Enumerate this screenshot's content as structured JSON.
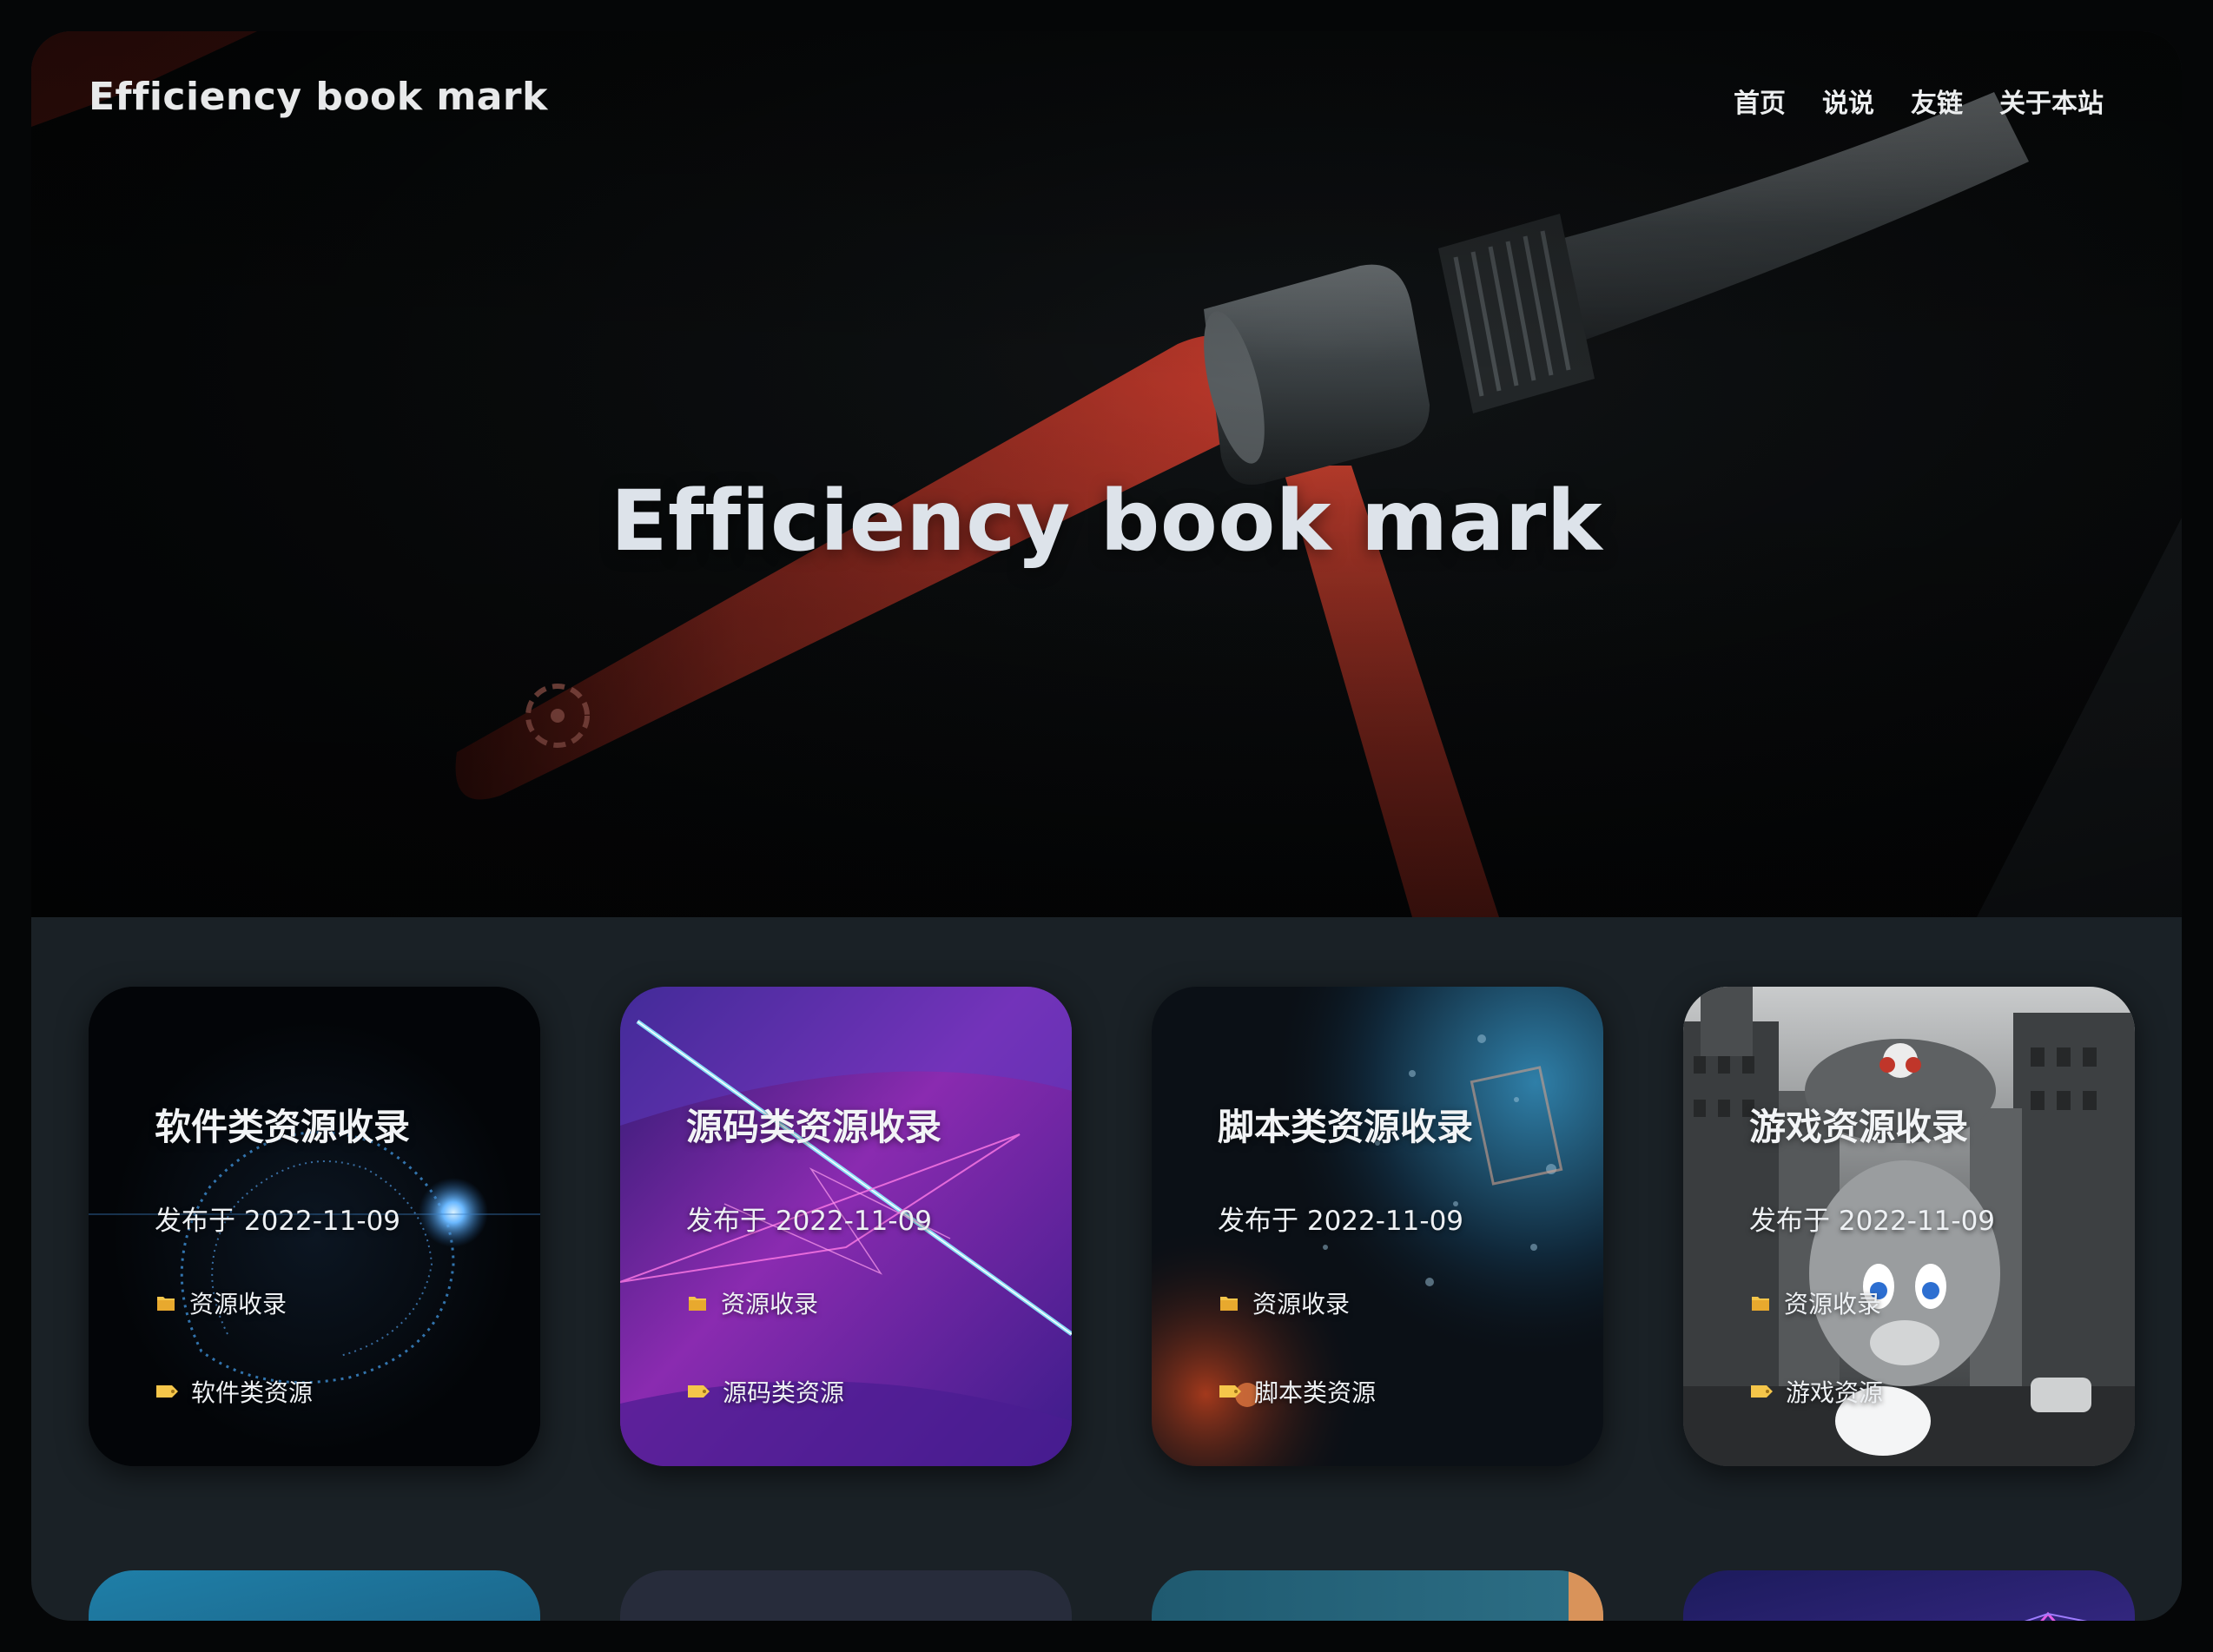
{
  "site": {
    "brand": "Efficiency book mark",
    "hero_title": "Efficiency book mark",
    "nav": [
      {
        "label": "首页"
      },
      {
        "label": "说说"
      },
      {
        "label": "友链"
      },
      {
        "label": "关于本站"
      }
    ]
  },
  "posts": [
    {
      "title": "软件类资源收录",
      "date": "发布于 2022-11-09",
      "category": "资源收录",
      "tag": "软件类资源"
    },
    {
      "title": "源码类资源收录",
      "date": "发布于 2022-11-09",
      "category": "资源收录",
      "tag": "源码类资源"
    },
    {
      "title": "脚本类资源收录",
      "date": "发布于 2022-11-09",
      "category": "资源收录",
      "tag": "脚本类资源"
    },
    {
      "title": "游戏资源收录",
      "date": "发布于 2022-11-09",
      "category": "资源收录",
      "tag": "游戏资源"
    }
  ],
  "icons": {
    "category": "folder-icon",
    "tag": "tag-icon"
  },
  "colors": {
    "page_bg": "#1a2126",
    "accent_red": "#c0362a",
    "icon_yellow": "#f5c64a"
  }
}
